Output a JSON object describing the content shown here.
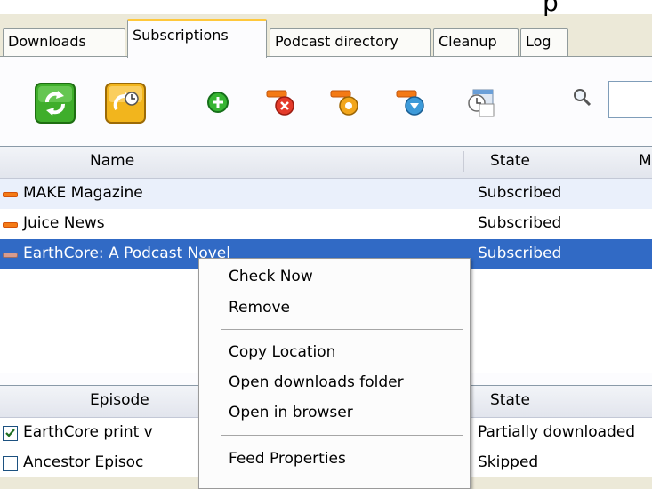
{
  "window": {
    "title_fragment": "p"
  },
  "tabs": [
    {
      "label": "Downloads",
      "active": false
    },
    {
      "label": "Subscriptions",
      "active": true
    },
    {
      "label": "Podcast directory",
      "active": false
    },
    {
      "label": "Cleanup",
      "active": false
    },
    {
      "label": "Log",
      "active": false
    }
  ],
  "toolbar": {
    "buttons": [
      {
        "icon": "refresh-icon"
      },
      {
        "icon": "schedule-icon"
      },
      {
        "icon": "add-feed-icon"
      },
      {
        "icon": "remove-feed-icon"
      },
      {
        "icon": "feed-settings-icon"
      },
      {
        "icon": "feed-download-icon"
      },
      {
        "icon": "scheduler-icon"
      }
    ],
    "search": {
      "icon": "search-icon",
      "value": ""
    }
  },
  "subscriptions": {
    "columns": {
      "name": "Name",
      "state": "State",
      "more": "M"
    },
    "rows": [
      {
        "name": "MAKE Magazine",
        "state": "Subscribed",
        "selected": false
      },
      {
        "name": "Juice News",
        "state": "Subscribed",
        "selected": false
      },
      {
        "name": "EarthCore:  A Podcast Novel",
        "state": "Subscribed",
        "selected": true
      }
    ]
  },
  "episodes": {
    "columns": {
      "episode": "Episode",
      "state": "State"
    },
    "rows": [
      {
        "name": "EarthCore print v",
        "state": "Partially downloaded",
        "checked": true
      },
      {
        "name": "Ancestor Episoc",
        "state": "Skipped",
        "checked": false
      }
    ]
  },
  "context_menu": {
    "items": [
      {
        "label": "Check Now"
      },
      {
        "label": "Remove"
      },
      {
        "label": "Copy Location"
      },
      {
        "label": "Open downloads folder"
      },
      {
        "label": "Open in browser"
      },
      {
        "label": "Feed Properties"
      }
    ]
  },
  "colors": {
    "selection": "#316ac5",
    "active_tab_accent": "#ffc83c",
    "feed_marker": "#f47a15"
  }
}
